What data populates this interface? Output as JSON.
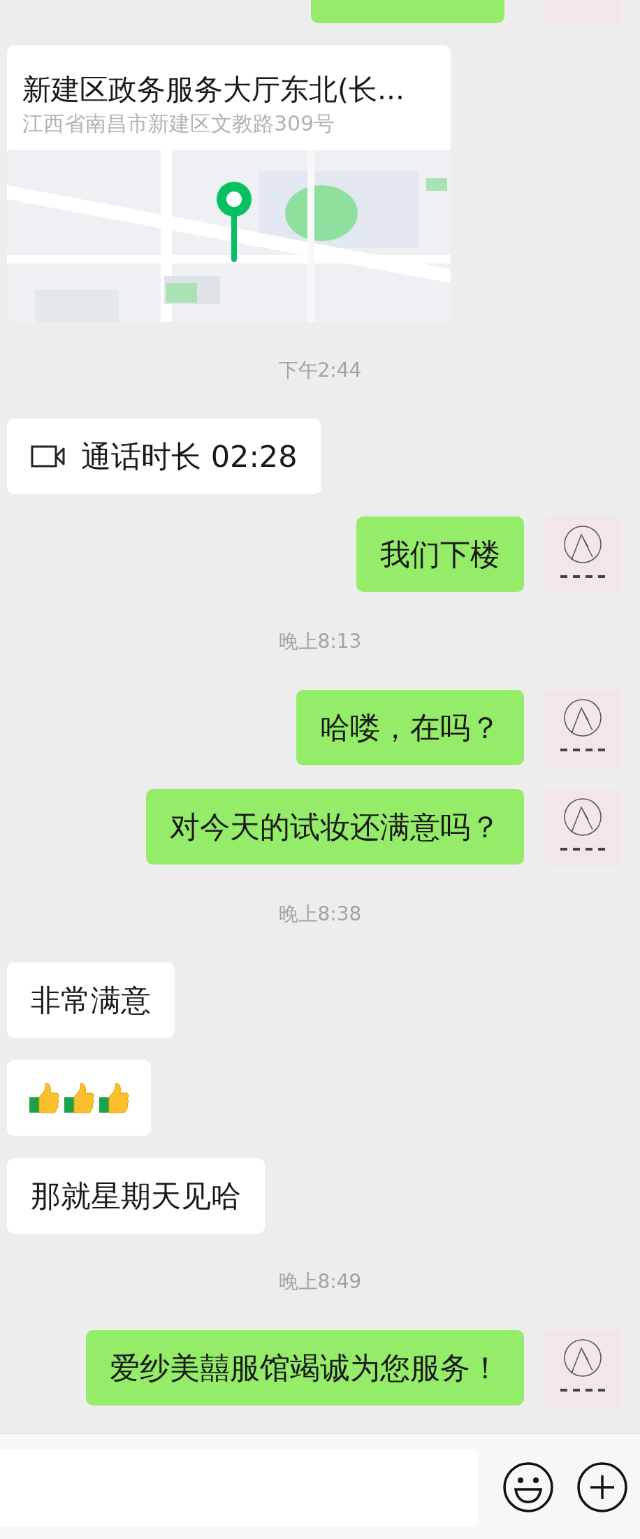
{
  "messages": [
    {
      "kind": "clipped",
      "outgoing": true
    },
    {
      "kind": "location",
      "outgoing": false,
      "title": "新建区政务服务大厅东北(长...",
      "address": "江西省南昌市新建区文教路309号"
    },
    {
      "kind": "time",
      "text": "下午2:44"
    },
    {
      "kind": "call",
      "outgoing": false,
      "text": "通话时长 02:28"
    },
    {
      "kind": "text",
      "outgoing": true,
      "text": "我们下楼"
    },
    {
      "kind": "time",
      "text": "晚上8:13"
    },
    {
      "kind": "text",
      "outgoing": true,
      "text": "哈喽，在吗？"
    },
    {
      "kind": "text",
      "outgoing": true,
      "text": "对今天的试妆还满意吗？"
    },
    {
      "kind": "time",
      "text": "晚上8:38"
    },
    {
      "kind": "text",
      "outgoing": false,
      "text": "非常满意"
    },
    {
      "kind": "emoji",
      "outgoing": false,
      "emoji": [
        {
          "kind": "thumbs_up"
        },
        {
          "kind": "thumbs_up"
        },
        {
          "kind": "thumbs_up"
        }
      ]
    },
    {
      "kind": "text",
      "outgoing": false,
      "text": "那就星期天见哈"
    },
    {
      "kind": "time",
      "text": "晚上8:49"
    },
    {
      "kind": "text",
      "outgoing": true,
      "text": "爱纱美囍服馆竭诚为您服务！"
    }
  ],
  "input_bar": {
    "buttons": [
      {
        "kind": "emoji"
      },
      {
        "kind": "more"
      }
    ]
  }
}
